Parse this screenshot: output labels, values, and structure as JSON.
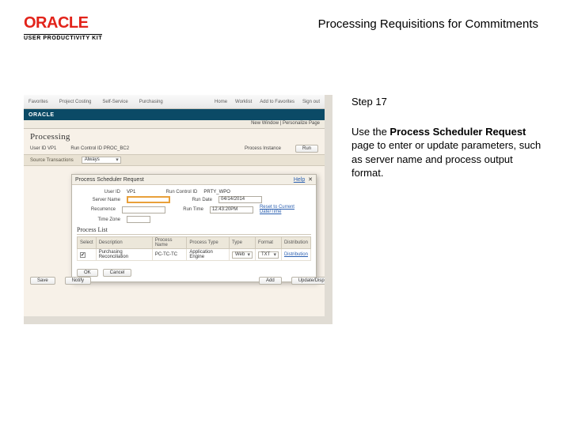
{
  "header": {
    "logo_text": "ORACLE",
    "logo_sub": "USER PRODUCTIVITY KIT",
    "doc_title": "Processing Requisitions for Commitments"
  },
  "step": {
    "title": "Step 17",
    "text_before": "Use the ",
    "text_bold": "Process Scheduler Request",
    "text_after": " page to enter or update parameters, such as server name and process output format."
  },
  "ss": {
    "nav": {
      "items": [
        "Favorites",
        "Project Costing",
        "Self-Service",
        "Purchasing"
      ],
      "right": [
        "Home",
        "Worklist",
        "Add to Favorites",
        "Sign out"
      ]
    },
    "brand": "ORACLE",
    "crumb": "New Window | Personalize Page",
    "page_title": "Processing",
    "ctx": {
      "user_label": "User ID",
      "user_val": "VP1",
      "run_ctl_label": "Run Control ID",
      "run_ctl_val": "PROC_BC2",
      "proc_inst_label": "Process Instance",
      "run_btn": "Run"
    },
    "band": {
      "label": "Source Transactions",
      "value": "Always"
    },
    "modal": {
      "title": "Process Scheduler Request",
      "help": "Help",
      "userid_lbl": "User ID",
      "userid_val": "VP1",
      "runctl_lbl": "Run Control ID",
      "runctl_val": "PRTY_WPO",
      "server_lbl": "Server Name",
      "rundate_lbl": "Run Date",
      "rundate_val": "04/14/2014",
      "recur_lbl": "Recurrence",
      "runtime_lbl": "Run Time",
      "runtime_val": "12:43:20PM",
      "reset_link": "Reset to Current Date/Time",
      "tz_lbl": "Time Zone",
      "section": "Process List",
      "headers": [
        "Select",
        "Description",
        "Process Name",
        "Process Type",
        "Type",
        "Format",
        "Distribution"
      ],
      "row": {
        "desc": "Purchasing Reconciliation",
        "proc": "PC-TC-TC",
        "ptype": "Application Engine",
        "type": "Web",
        "fmt": "TXT",
        "dist": "Distribution"
      },
      "ok": "OK",
      "cancel": "Cancel"
    },
    "under": {
      "save": "Save",
      "notify": "Notify",
      "add": "Add",
      "upd": "Update/Display"
    }
  }
}
